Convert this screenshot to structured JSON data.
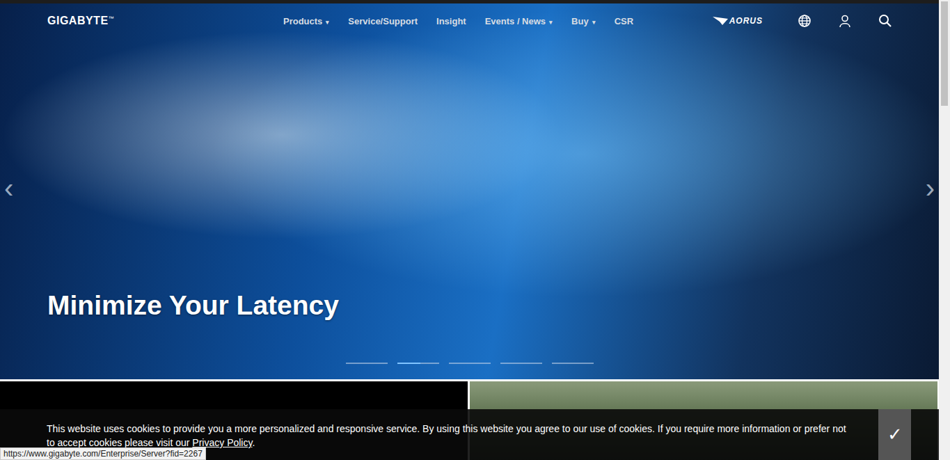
{
  "logo": {
    "text": "GIGABYTE",
    "mark": "™"
  },
  "nav": [
    {
      "label": "Products",
      "caret": "▾"
    },
    {
      "label": "Service/Support",
      "caret": ""
    },
    {
      "label": "Insight",
      "caret": ""
    },
    {
      "label": "Events / News",
      "caret": "▾"
    },
    {
      "label": "Buy",
      "caret": "▾"
    },
    {
      "label": "CSR",
      "caret": ""
    }
  ],
  "brand": "AORUS",
  "hero": {
    "headline": "Minimize Your Latency",
    "prev": "‹",
    "next": "›",
    "slides": [
      {
        "selected": false
      },
      {
        "selected": true
      },
      {
        "selected": false
      },
      {
        "selected": false
      },
      {
        "selected": false
      }
    ]
  },
  "cookie": {
    "text": "This website uses cookies to provide you a more personalized and responsive service. By using this website you agree to our use of cookies. If you require more information or prefer not to accept cookies please visit our ",
    "link": "Privacy Policy",
    "end": ".",
    "accept": "✓"
  },
  "status_url": "https://www.gigabyte.com/Enterprise/Server?fid=2267"
}
